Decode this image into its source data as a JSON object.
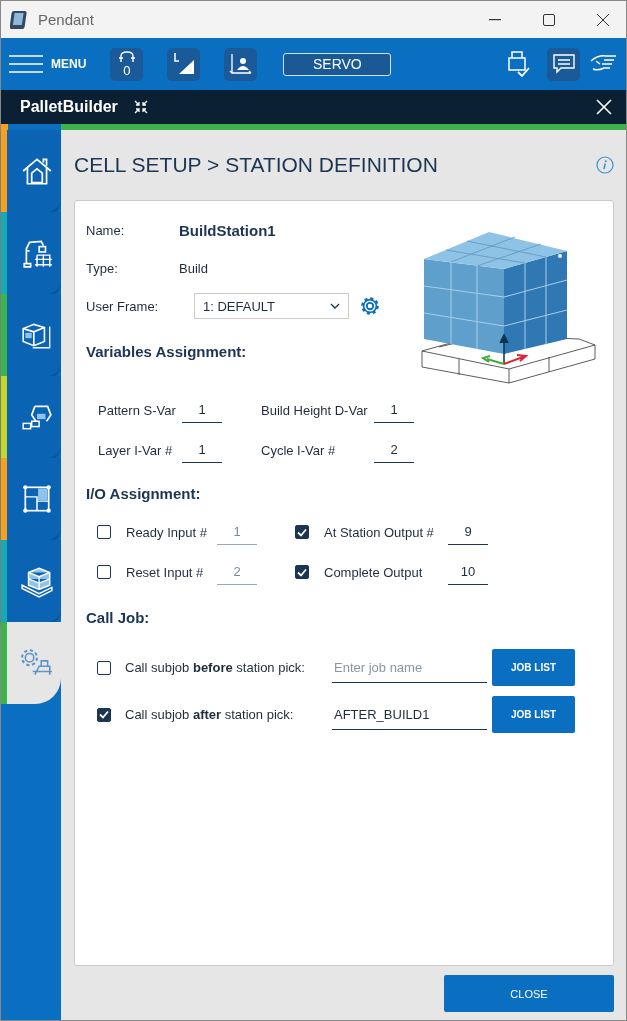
{
  "window": {
    "title": "Pendant"
  },
  "toolbar": {
    "menu_label": "MENU",
    "counter": "0",
    "mode_button": "SERVO"
  },
  "app_bar": {
    "title": "PalletBuilder"
  },
  "sidebar": {
    "tabs": [
      {
        "kind": "home",
        "color": "#f5a01e",
        "selected": false
      },
      {
        "kind": "robot",
        "color": "#16aab4",
        "selected": false
      },
      {
        "kind": "box",
        "color": "#3cb44b",
        "selected": false
      },
      {
        "kind": "gripper",
        "color": "#c3d72d",
        "selected": false
      },
      {
        "kind": "layout",
        "color": "#f5a01e",
        "selected": false
      },
      {
        "kind": "pallet",
        "color": "#16aab4",
        "selected": false
      },
      {
        "kind": "settings",
        "color": "#3cb44b",
        "selected": true
      }
    ]
  },
  "page_title": "CELL SETUP > STATION DEFINITION",
  "station": {
    "name_label": "Name:",
    "name": "BuildStation1",
    "type_label": "Type:",
    "type": "Build",
    "frame_label": "User Frame:",
    "frame": "1: DEFAULT"
  },
  "variables": {
    "heading": "Variables Assignment:",
    "items": [
      {
        "label": "Pattern S-Var",
        "value": "1"
      },
      {
        "label": "Build Height D-Var",
        "value": "1"
      },
      {
        "label": "Layer I-Var #",
        "value": "1"
      },
      {
        "label": "Cycle I-Var #",
        "value": "2"
      }
    ]
  },
  "io": {
    "heading": "I/O Assignment:",
    "items": [
      {
        "label": "Ready Input #",
        "checked": false,
        "value": "1"
      },
      {
        "label": "At Station Output #",
        "checked": true,
        "value": "9"
      },
      {
        "label": "Reset Input #",
        "checked": false,
        "value": "2"
      },
      {
        "label": "Complete Output",
        "checked": true,
        "value": "10"
      }
    ]
  },
  "call_job": {
    "heading": "Call Job:",
    "rows": [
      {
        "label": "Call subjob **before** station pick:",
        "checked": false,
        "placeholder": "Enter job name",
        "button": "JOB LIST"
      },
      {
        "label": "Call subjob **after** station pick:",
        "checked": true,
        "value": "AFTER_BUILD1",
        "button": "JOB LIST"
      }
    ]
  },
  "close_button": "CLOSE"
}
